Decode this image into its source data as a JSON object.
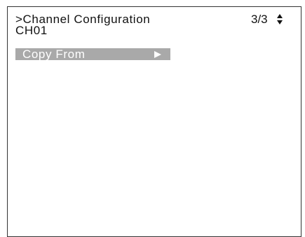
{
  "header": {
    "title": ">Channel Configuration",
    "page_indicator": "3/3",
    "scroll_icon": "up-down-arrows-icon"
  },
  "channel": {
    "label": "CH01"
  },
  "menu": {
    "items": [
      {
        "label": "Copy From",
        "icon": "right-triangle-arrow-icon",
        "selected": true
      }
    ]
  },
  "colors": {
    "background": "#ffffff",
    "text": "#111111",
    "highlight": "#a9a9a9",
    "highlight_text": "#ffffff",
    "border": "#333333"
  }
}
